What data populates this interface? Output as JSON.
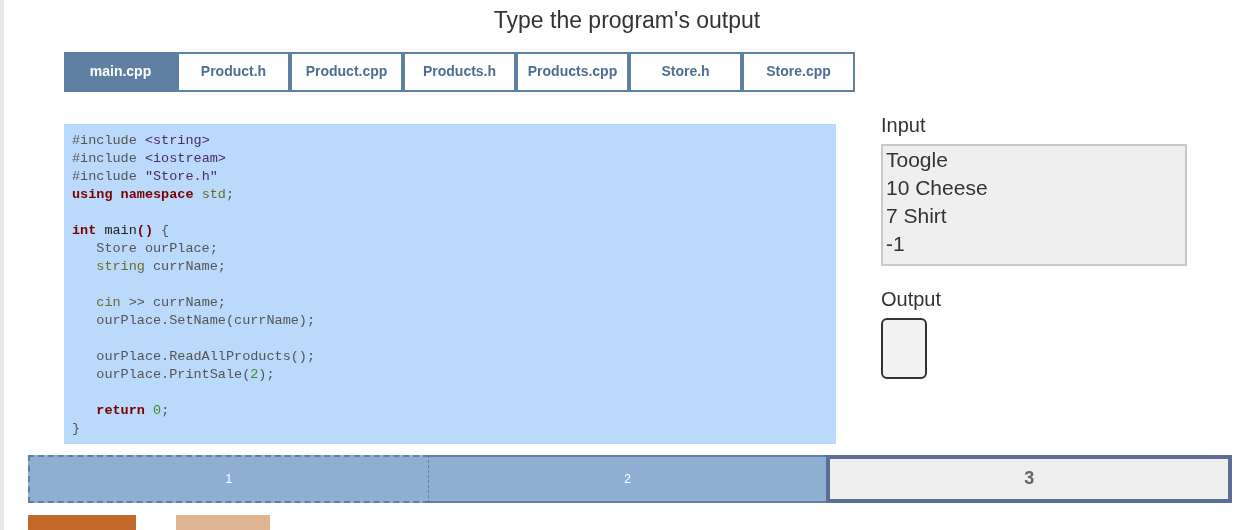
{
  "title": "Type the program's output",
  "tabs": [
    {
      "label": "main.cpp",
      "selected": true
    },
    {
      "label": "Product.h",
      "selected": false
    },
    {
      "label": "Product.cpp",
      "selected": false
    },
    {
      "label": "Products.h",
      "selected": false
    },
    {
      "label": "Products.cpp",
      "selected": false
    },
    {
      "label": "Store.h",
      "selected": false
    },
    {
      "label": "Store.cpp",
      "selected": false
    }
  ],
  "code": [
    {
      "kind": "code",
      "tokens": [
        {
          "kind": "pre",
          "text": "#include "
        },
        {
          "kind": "str",
          "text": "<string>"
        }
      ]
    },
    {
      "kind": "code",
      "tokens": [
        {
          "kind": "pre",
          "text": "#include "
        },
        {
          "kind": "str",
          "text": "<iostream>"
        }
      ]
    },
    {
      "kind": "code",
      "tokens": [
        {
          "kind": "pre",
          "text": "#include "
        },
        {
          "kind": "str",
          "text": "\"Store.h\""
        }
      ]
    },
    {
      "kind": "code",
      "tokens": [
        {
          "kind": "kw",
          "text": "using namespace "
        },
        {
          "kind": "type",
          "text": "std"
        },
        {
          "kind": "plain",
          "text": ";"
        }
      ]
    },
    {
      "kind": "blank"
    },
    {
      "kind": "code",
      "tokens": [
        {
          "kind": "kw",
          "text": "int "
        },
        {
          "kind": "name",
          "text": "main"
        },
        {
          "kind": "kw",
          "text": "()"
        },
        {
          "kind": "plain",
          "text": " {"
        }
      ]
    },
    {
      "kind": "code",
      "tokens": [
        {
          "kind": "plain",
          "text": "   Store ourPlace;"
        }
      ]
    },
    {
      "kind": "code",
      "tokens": [
        {
          "kind": "type",
          "text": "   string "
        },
        {
          "kind": "plain",
          "text": "currName;"
        }
      ]
    },
    {
      "kind": "blank"
    },
    {
      "kind": "code",
      "tokens": [
        {
          "kind": "type",
          "text": "   cin "
        },
        {
          "kind": "plain",
          "text": ">> currName;"
        }
      ]
    },
    {
      "kind": "code",
      "tokens": [
        {
          "kind": "plain",
          "text": "   ourPlace.SetName(currName);"
        }
      ]
    },
    {
      "kind": "blank"
    },
    {
      "kind": "code",
      "tokens": [
        {
          "kind": "plain",
          "text": "   ourPlace.ReadAllProducts();"
        }
      ]
    },
    {
      "kind": "code",
      "tokens": [
        {
          "kind": "plain",
          "text": "   ourPlace.PrintSale("
        },
        {
          "kind": "num",
          "text": "2"
        },
        {
          "kind": "plain",
          "text": ");"
        }
      ]
    },
    {
      "kind": "blank"
    },
    {
      "kind": "code",
      "tokens": [
        {
          "kind": "kw",
          "text": "   return "
        },
        {
          "kind": "num",
          "text": "0"
        },
        {
          "kind": "plain",
          "text": ";"
        }
      ]
    },
    {
      "kind": "code",
      "tokens": [
        {
          "kind": "plain",
          "text": "}"
        }
      ]
    }
  ],
  "input": {
    "label": "Input",
    "lines": [
      "Toogle",
      "10 Cheese",
      "7 Shirt",
      "-1"
    ]
  },
  "output": {
    "label": "Output"
  },
  "steps": [
    {
      "label": "1",
      "selected": false
    },
    {
      "label": "2",
      "selected": false
    },
    {
      "label": "3",
      "selected": true
    }
  ],
  "buttons": [
    {
      "disabled": false
    },
    {
      "disabled": true
    }
  ]
}
